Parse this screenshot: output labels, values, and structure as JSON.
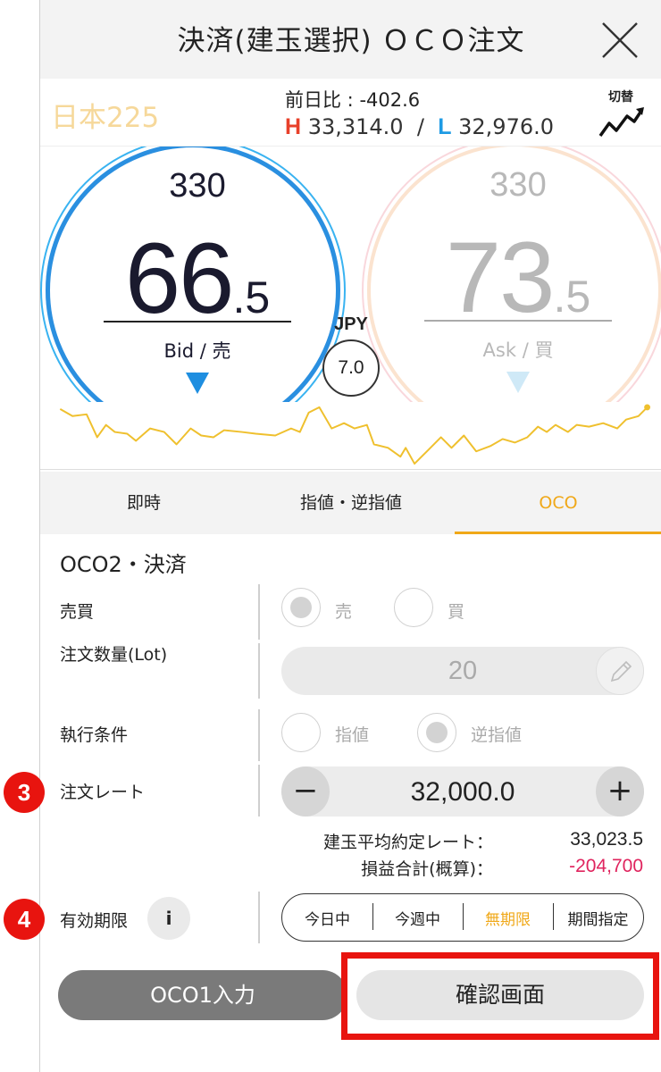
{
  "header": {
    "title": "決済(建玉選択) ＯＣＯ注文"
  },
  "market": {
    "symbol": "日本225",
    "change_label": "前日比 :",
    "change_value": "-402.6",
    "high_letter": "H",
    "high_value": "33,314.0",
    "separator": "/",
    "low_letter": "L",
    "low_value": "32,976.0",
    "switch_label": "切替"
  },
  "bid": {
    "qty": "330",
    "main": "66",
    "decimal": ".5",
    "label": "Bid / 売"
  },
  "ask": {
    "qty": "330",
    "main": "73",
    "decimal": ".5",
    "label": "Ask / 買"
  },
  "spread": {
    "currency": "JPY",
    "value": "7.0"
  },
  "tabs": [
    {
      "label": "即時"
    },
    {
      "label": "指値・逆指値"
    },
    {
      "label": "OCO"
    }
  ],
  "form": {
    "section_title": "OCO2・決済",
    "side_label": "売買",
    "side_options": [
      "売",
      "買"
    ],
    "side_selected": "売",
    "qty_label": "注文数量(Lot)",
    "qty_value": "20",
    "cond_label": "執行条件",
    "cond_options": [
      "指値",
      "逆指値"
    ],
    "cond_selected": "逆指値",
    "rate_label": "注文レート",
    "rate_value": "32,000.0",
    "minus": "−",
    "plus": "+",
    "avg_rate_label": "建玉平均約定レート：",
    "avg_rate_value": "33,023.5",
    "pnl_label": "損益合計(概算)：",
    "pnl_value": "-204,700",
    "expiry_label": "有効期限",
    "info": "i",
    "expiry_options": [
      "今日中",
      "今週中",
      "無期限",
      "期間指定"
    ],
    "expiry_selected": "無期限"
  },
  "buttons": {
    "oco1": "OCO1入力",
    "confirm": "確認画面"
  },
  "steps": {
    "step3": "3",
    "step4": "4"
  },
  "colors": {
    "accent": "#f0a818",
    "bid_blue": "#2a8fe0",
    "negative": "#e0245e",
    "highlight": "#e8140f"
  }
}
